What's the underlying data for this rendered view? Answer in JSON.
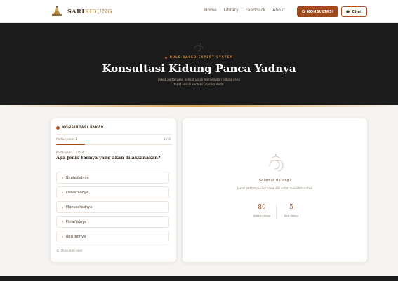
{
  "nav": {
    "brand_prefix": "SARI",
    "brand_suffix": "KIDUNG",
    "links": [
      "Home",
      "Library",
      "Feedback",
      "About"
    ],
    "consult_button": "KONSULTASI",
    "chat_button": "Chat",
    "icons": {
      "consult": "search-icon",
      "chat": "chat-bubble-icon",
      "logo": "balinese-temple-logo"
    }
  },
  "hero": {
    "kicker": "RULE-BASED EXPERT SYSTEM",
    "title": "Konsultasi Kidung Panca Yadnya",
    "subtitle": "Jawab pertanyaan berikut untuk menemukan kidung yang tepat sesuai konteks upacara Anda."
  },
  "consult_panel": {
    "heading": "KONSULTASI PAKAR",
    "progress_label": "Pertanyaan 1",
    "progress_count": "1 / 4",
    "progress_fraction": 0.25,
    "question_step": "Pertanyaan 1 dari 4",
    "question": "Apa Jenis Yadnya yang akan dilaksanakan?",
    "options": [
      "BhutaYadnya",
      "DewaYadnya",
      "ManusaYadnya",
      "PitraYadnya",
      "ResiYadnya"
    ],
    "restart_label": "Mulai dari awal"
  },
  "welcome_panel": {
    "title": "Selamat datang!",
    "subtitle": "Jawab pertanyaan di panel kiri untuk mulai konsultasi",
    "stats": [
      {
        "value": "80",
        "label": "Koleksi Kidung"
      },
      {
        "value": "5",
        "label": "Jenis Yadnya"
      }
    ]
  },
  "colors": {
    "accent": "#9c4a1e",
    "gold": "#c48b3f",
    "hero_bg": "#1b1b1b",
    "page_bg": "#f6f4f1"
  }
}
